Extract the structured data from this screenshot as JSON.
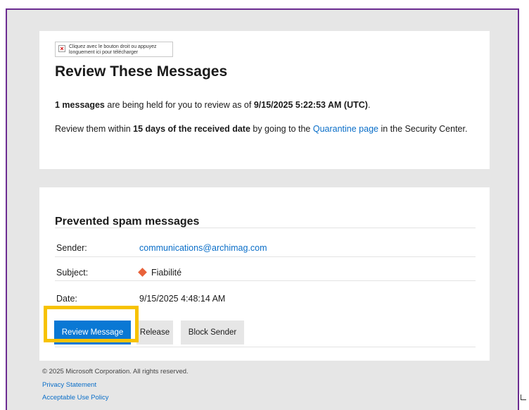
{
  "header": {
    "image_alt": "Cliquez avec le bouton droit ou appuyez longuement ici pour télécharger",
    "title": "Review These Messages"
  },
  "summary": {
    "count_bold": "1 messages",
    "middle": " are being held for you to review as of ",
    "date_bold": "9/15/2025 5:22:53 AM (UTC)",
    "end": "."
  },
  "instructions": {
    "prefix": "Review them within ",
    "days_bold": "15 days of the received date",
    "middle": " by going to the ",
    "link_label": "Quarantine page",
    "suffix": " in the Security Center."
  },
  "section": {
    "title": "Prevented spam messages",
    "sender_label": "Sender:",
    "sender_value": "communications@archimag.com",
    "subject_label": "Subject:",
    "subject_value": "Fiabilité",
    "date_label": "Date:",
    "date_value": "9/15/2025 4:48:14 AM"
  },
  "buttons": {
    "review": "Review Message",
    "release": "Release",
    "block": "Block Sender"
  },
  "footer": {
    "copyright": "© 2025 Microsoft Corporation. All rights reserved.",
    "privacy": "Privacy Statement",
    "aup": "Acceptable Use Policy"
  },
  "colors": {
    "frame_border": "#6b2c91",
    "primary_button": "#0a78d4",
    "link": "#0a6ec8",
    "highlight": "#f7c200",
    "subject_icon": "#e8623a"
  }
}
